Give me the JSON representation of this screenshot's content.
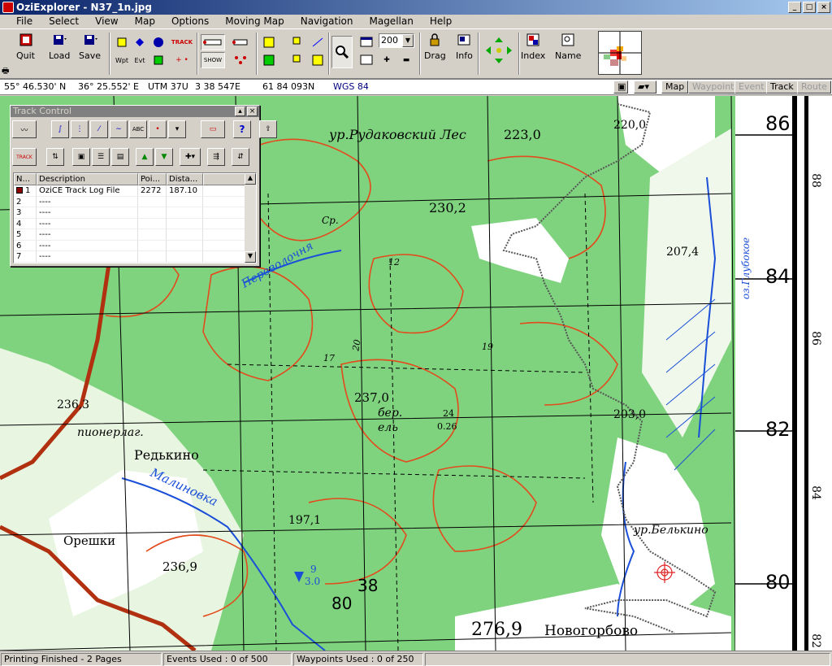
{
  "window": {
    "title": "OziExplorer - N37_1n.jpg",
    "buttons": [
      "_",
      "□",
      "×"
    ]
  },
  "menu": [
    "File",
    "Select",
    "View",
    "Map",
    "Options",
    "Moving Map",
    "Navigation",
    "Magellan",
    "Help"
  ],
  "toolbar": {
    "quit": "Quit",
    "load": "Load",
    "save": "Save",
    "wpt": "Wpt",
    "evt": "Evt",
    "track": "TRACK",
    "show": "SHOW",
    "zoom_value": "200",
    "drag": "Drag",
    "info": "Info",
    "index": "Index",
    "name": "Name"
  },
  "coords": {
    "lat": "55° 46.530' N",
    "lon": "36° 25.552' E",
    "utm_zone": "UTM 37U",
    "utm_e": "3 38 547E",
    "utm_n": "61 84 093N",
    "datum": "WGS 84"
  },
  "modes": [
    {
      "label": "Map",
      "enabled": true
    },
    {
      "label": "Waypoint",
      "enabled": false
    },
    {
      "label": "Event",
      "enabled": false
    },
    {
      "label": "Track",
      "enabled": true
    },
    {
      "label": "Route",
      "enabled": false
    }
  ],
  "track_control": {
    "title": "Track Control",
    "columns": [
      "N...",
      "Description",
      "Poi...",
      "Dista..."
    ],
    "rows": [
      {
        "n": "1",
        "desc": "OziCE Track Log File",
        "points": "2272",
        "dist": "187.10",
        "color": "#8b0000"
      },
      {
        "n": "2",
        "desc": "----",
        "points": "",
        "dist": ""
      },
      {
        "n": "3",
        "desc": "----",
        "points": "",
        "dist": ""
      },
      {
        "n": "4",
        "desc": "----",
        "points": "",
        "dist": ""
      },
      {
        "n": "5",
        "desc": "----",
        "points": "",
        "dist": ""
      },
      {
        "n": "6",
        "desc": "----",
        "points": "",
        "dist": ""
      },
      {
        "n": "7",
        "desc": "----",
        "points": "",
        "dist": ""
      }
    ]
  },
  "map_labels": {
    "forest": "ур.Рудаковский Лес",
    "h223": "223,0",
    "h220": "220,0",
    "h2302": "230,2",
    "h2074": "207,4",
    "h2363": "236,3",
    "pioner": "пионерлаг.",
    "redkino": "Редькино",
    "malinovka": "Малиновка",
    "perevolochnya": "Переволочня",
    "h2370": "237,0",
    "ber": "бер.",
    "el": "ель",
    "tree_h": "24",
    "tree_d": "0.26",
    "h2030": "203,0",
    "h1971": "197,1",
    "oreshki": "Орешки",
    "h2369": "236,9",
    "belkino": "ур.Белькино",
    "h2769": "276,9",
    "novogorbovo": "Новогорбово",
    "glubokoe": "оз.Глубокое",
    "g38": "38",
    "g80": "80",
    "r86": "86",
    "r84": "84",
    "r82": "82",
    "r80": "80",
    "v88": "88",
    "v86": "86",
    "v84": "84",
    "v82": "82",
    "cp": "Ср.",
    "m9": "9",
    "m30": "3.0",
    "g17": "17",
    "g19": "19",
    "g20": "20",
    "g12": "12"
  },
  "status": {
    "printing": "Printing Finished - 2 Pages",
    "events": "Events Used : 0 of 500",
    "waypoints": "Waypoints Used : 0 of 250"
  }
}
